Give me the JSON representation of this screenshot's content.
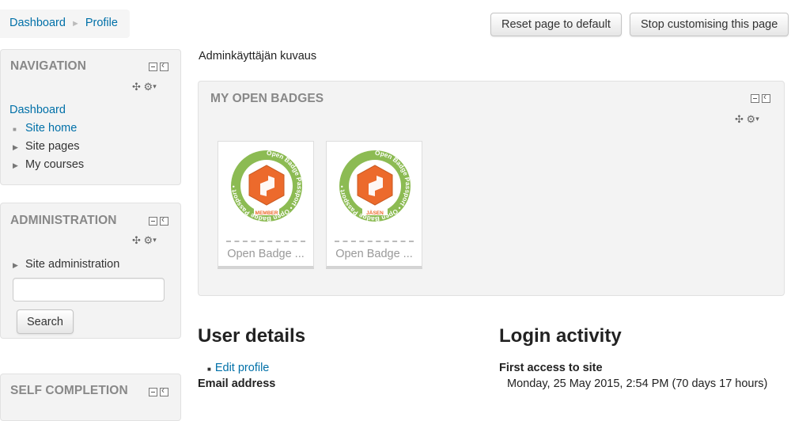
{
  "breadcrumb": {
    "home": "Dashboard",
    "separator": "►",
    "current": "Profile"
  },
  "header": {
    "reset_label": "Reset page to default",
    "stop_label": "Stop customising this page"
  },
  "navigation": {
    "title": "NAVIGATION",
    "dashboard": "Dashboard",
    "items": [
      {
        "label": "Site home",
        "icon": "square-bullet-icon"
      },
      {
        "label": "Site pages",
        "icon": "triangle-right-icon"
      },
      {
        "label": "My courses",
        "icon": "triangle-right-icon"
      }
    ]
  },
  "administration": {
    "title": "ADMINISTRATION",
    "item": "Site administration",
    "search_value": "",
    "search_button": "Search"
  },
  "self_completion": {
    "title": "SELF COMPLETION"
  },
  "profile": {
    "description": "Adminkäyttäjän kuvaus"
  },
  "badges_block": {
    "title": "MY OPEN BADGES",
    "badges": [
      {
        "name": "Open Badge ...",
        "ring_text": "Open Badge Passport • Open Badge Passport •",
        "ribbon": "MEMBER"
      },
      {
        "name": "Open Badge ...",
        "ring_text": "Open Badge Passport • Open Badge Passport •",
        "ribbon": "JÄSEN"
      }
    ]
  },
  "user_details": {
    "heading": "User details",
    "edit_profile": "Edit profile",
    "email_label": "Email address"
  },
  "login_activity": {
    "heading": "Login activity",
    "first_access_label": "First access to site",
    "first_access_value": "Monday, 25 May 2015, 2:54 PM  (70 days 17 hours)"
  },
  "colors": {
    "link": "#0070a8",
    "badge_green": "#8cbb53",
    "badge_orange": "#ec6a2c",
    "block_bg": "#f3f3f3"
  }
}
